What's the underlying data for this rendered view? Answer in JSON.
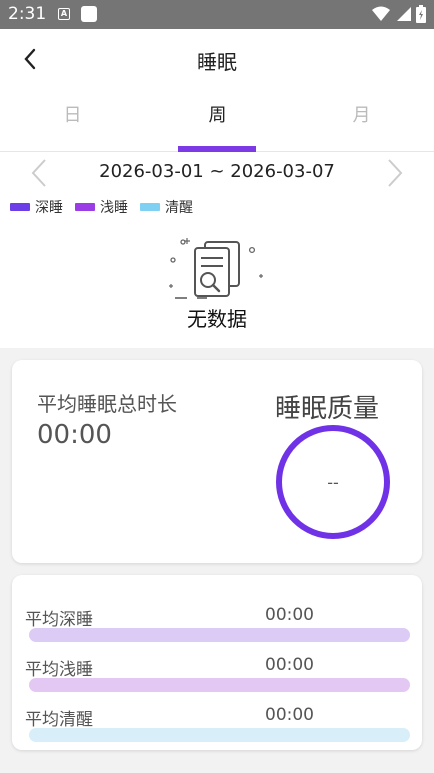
{
  "statusbar": {
    "time": "2:31",
    "a_icon_text": "A"
  },
  "appbar": {
    "title": "睡眠",
    "back_icon": "chevron-left-icon"
  },
  "tabs": {
    "items": [
      {
        "label": "日"
      },
      {
        "label": "周"
      },
      {
        "label": "月"
      }
    ],
    "active_index": 1,
    "active_color": "#7c3ae6"
  },
  "chart": {
    "date_range": "2026-03-01 ~ 2026-03-07",
    "legend": [
      {
        "label": "深睡",
        "color": "#6b3ee8"
      },
      {
        "label": "浅睡",
        "color": "#9a3de6"
      },
      {
        "label": "清醒",
        "color": "#7fd0f2"
      }
    ],
    "empty_text": "无数据"
  },
  "summary": {
    "avg_total_label": "平均睡眠总时长",
    "avg_total_value": "00:00",
    "quality_label": "睡眠质量",
    "quality_value": "--",
    "ring_color": "#7032e6"
  },
  "stats": [
    {
      "label": "平均深睡",
      "value": "00:00",
      "bar_color": "#dccbf5"
    },
    {
      "label": "平均浅睡",
      "value": "00:00",
      "bar_color": "#e3c8f3"
    },
    {
      "label": "平均清醒",
      "value": "00:00",
      "bar_color": "#d8eef9"
    }
  ]
}
